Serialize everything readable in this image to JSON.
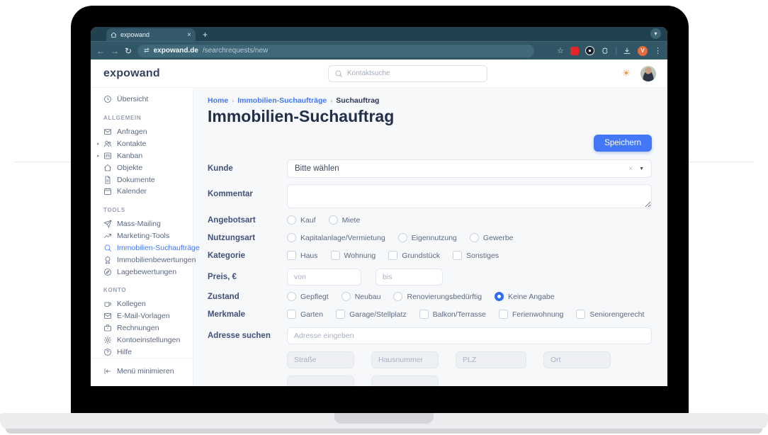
{
  "accent_color": "#4377f6",
  "browser": {
    "tab_title": "expowand",
    "tab_close": "×",
    "new_tab": "+",
    "back": "←",
    "forward": "→",
    "reload": "↻",
    "url_domain": "expowand.de",
    "url_path": "/searchrequests/new",
    "star": "☆",
    "profile_initial": "V",
    "kebab": "⋮",
    "chevron": "▾",
    "tune_icon": "⇄"
  },
  "app_header": {
    "logo": "expowand",
    "search_placeholder": "Kontaktsuche",
    "sun": "☀"
  },
  "sidebar": {
    "overview": {
      "label": "Übersicht"
    },
    "sections": [
      {
        "title": "ALLGEMEIN",
        "items": [
          {
            "label": "Anfragen"
          },
          {
            "label": "Kontakte",
            "expandable": true
          },
          {
            "label": "Kanban",
            "expandable": true
          },
          {
            "label": "Objekte"
          },
          {
            "label": "Dokumente"
          },
          {
            "label": "Kalender"
          }
        ]
      },
      {
        "title": "TOOLS",
        "items": [
          {
            "label": "Mass-Mailing"
          },
          {
            "label": "Marketing-Tools"
          },
          {
            "label": "Immobilien-Suchaufträge",
            "active": true
          },
          {
            "label": "Immobilienbewertungen"
          },
          {
            "label": "Lagebewertungen"
          }
        ]
      },
      {
        "title": "KONTO",
        "items": [
          {
            "label": "Kollegen"
          },
          {
            "label": "E-Mail-Vorlagen"
          },
          {
            "label": "Rechnungen"
          },
          {
            "label": "Kontoeinstellungen"
          },
          {
            "label": "Hilfe"
          }
        ]
      }
    ],
    "collapse_label": "Menü minimieren",
    "expand_caret": "▸"
  },
  "main": {
    "breadcrumb": {
      "home": "Home",
      "parent": "Immobilien-Suchaufträge",
      "current": "Suchauftrag",
      "sep": "›"
    },
    "page_title": "Immobilien-Suchauftrag",
    "save_label": "Speichern"
  },
  "form": {
    "kunde": {
      "label": "Kunde",
      "value": "Bitte wählen",
      "clear": "×",
      "arrow": "▼"
    },
    "kommentar": {
      "label": "Kommentar",
      "value": ""
    },
    "angebotsart": {
      "label": "Angebotsart",
      "options": [
        "Kauf",
        "Miete"
      ]
    },
    "nutzungsart": {
      "label": "Nutzungsart",
      "options": [
        "Kapitalanlage/Vermietung",
        "Eigennutzung",
        "Gewerbe"
      ]
    },
    "kategorie": {
      "label": "Kategorie",
      "options": [
        "Haus",
        "Wohnung",
        "Grundstück",
        "Sonstiges"
      ]
    },
    "preis": {
      "label": "Preis, €",
      "von_placeholder": "von",
      "bis_placeholder": "bis"
    },
    "zustand": {
      "label": "Zustand",
      "options": [
        "Gepflegt",
        "Neubau",
        "Renovierungsbedürftig",
        "Keine Angabe"
      ],
      "selected": "Keine Angabe"
    },
    "merkmale": {
      "label": "Merkmale",
      "options": [
        "Garten",
        "Garage/Stellplatz",
        "Balkon/Terrasse",
        "Ferienwohnung",
        "Seniorengerecht"
      ]
    },
    "adresse": {
      "label": "Adresse suchen",
      "placeholder": "Adresse eingeben"
    },
    "address_fields": [
      "Straße",
      "Hausnummer",
      "PLZ",
      "Ort"
    ]
  }
}
